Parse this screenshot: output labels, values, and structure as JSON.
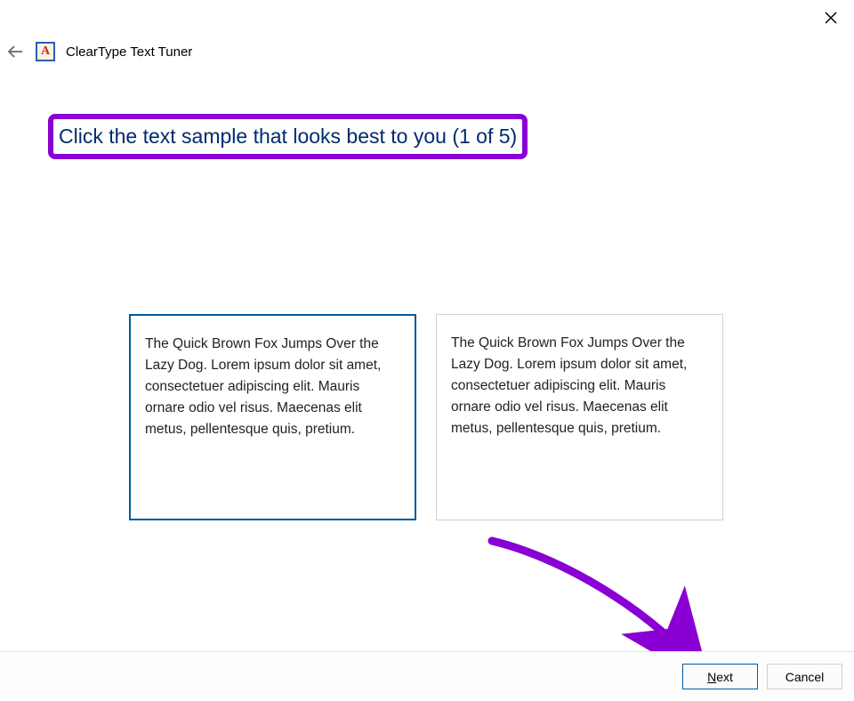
{
  "window": {
    "title": "ClearType Text Tuner"
  },
  "instruction": {
    "text": "Click the text sample that looks best to you (1 of 5)"
  },
  "samples": {
    "item0": "The Quick Brown Fox Jumps Over the Lazy Dog. Lorem ipsum dolor sit amet, consectetuer adipiscing elit. Mauris ornare odio vel risus. Maecenas elit metus, pellentesque quis, pretium.",
    "item1": "The Quick Brown Fox Jumps Over the Lazy Dog. Lorem ipsum dolor sit amet, consectetuer adipiscing elit. Mauris ornare odio vel risus. Maecenas elit metus, pellentesque quis, pretium."
  },
  "buttons": {
    "next_prefix": "N",
    "next_rest": "ext",
    "cancel": "Cancel"
  },
  "annotation": {
    "highlight_color": "#8a00d4"
  }
}
